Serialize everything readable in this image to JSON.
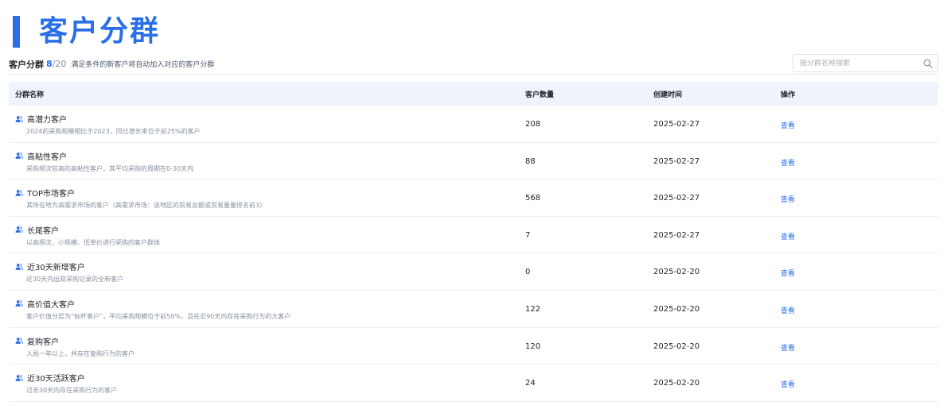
{
  "page": {
    "title": "客户分群"
  },
  "subheader": {
    "title": "客户分群",
    "count_current": "8",
    "count_total": "/20",
    "description": "满足条件的新客户将自动加入对应的客户分群"
  },
  "search": {
    "placeholder": "按分群名称搜索",
    "icon": "search-icon"
  },
  "table": {
    "columns": {
      "name": "分群名称",
      "count": "客户数量",
      "created": "创建时间",
      "action": "操作"
    },
    "rows": [
      {
        "name": "高潜力客户",
        "desc": "2024的采购规模相比于2023，同比增长率位于前25%的客户",
        "count": "208",
        "created": "2025-02-27",
        "action": "查看"
      },
      {
        "name": "高粘性客户",
        "desc": "采购频次较高的高粘性客户，其平均采购的周期在0-30天内",
        "count": "88",
        "created": "2025-02-27",
        "action": "查看"
      },
      {
        "name": "TOP市场客户",
        "desc": "其所在地为高需求市场的客户（高需求市场：该地区的贸易总额或贸易量量排名前3）",
        "count": "568",
        "created": "2025-02-27",
        "action": "查看"
      },
      {
        "name": "长尾客户",
        "desc": "以高频次、小规模、低单价进行采购的客户群体",
        "count": "7",
        "created": "2025-02-27",
        "action": "查看"
      },
      {
        "name": "近30天新增客户",
        "desc": "近30天内出现采购记录的全新客户",
        "count": "0",
        "created": "2025-02-20",
        "action": "查看"
      },
      {
        "name": "高价值大客户",
        "desc": "客户价值分层为“标杆客户”，平均采购规模位于前50%，且在近90天内存在采购行为的大客户",
        "count": "122",
        "created": "2025-02-20",
        "action": "查看"
      },
      {
        "name": "复购客户",
        "desc": "入局一年以上，并存在复购行为的客户",
        "count": "120",
        "created": "2025-02-20",
        "action": "查看"
      },
      {
        "name": "近30天活跃客户",
        "desc": "过去30天内存在采购行为的客户",
        "count": "24",
        "created": "2025-02-20",
        "action": "查看"
      }
    ]
  },
  "colors": {
    "accent": "#2a6fe8",
    "header_bg": "#eef3fc"
  }
}
